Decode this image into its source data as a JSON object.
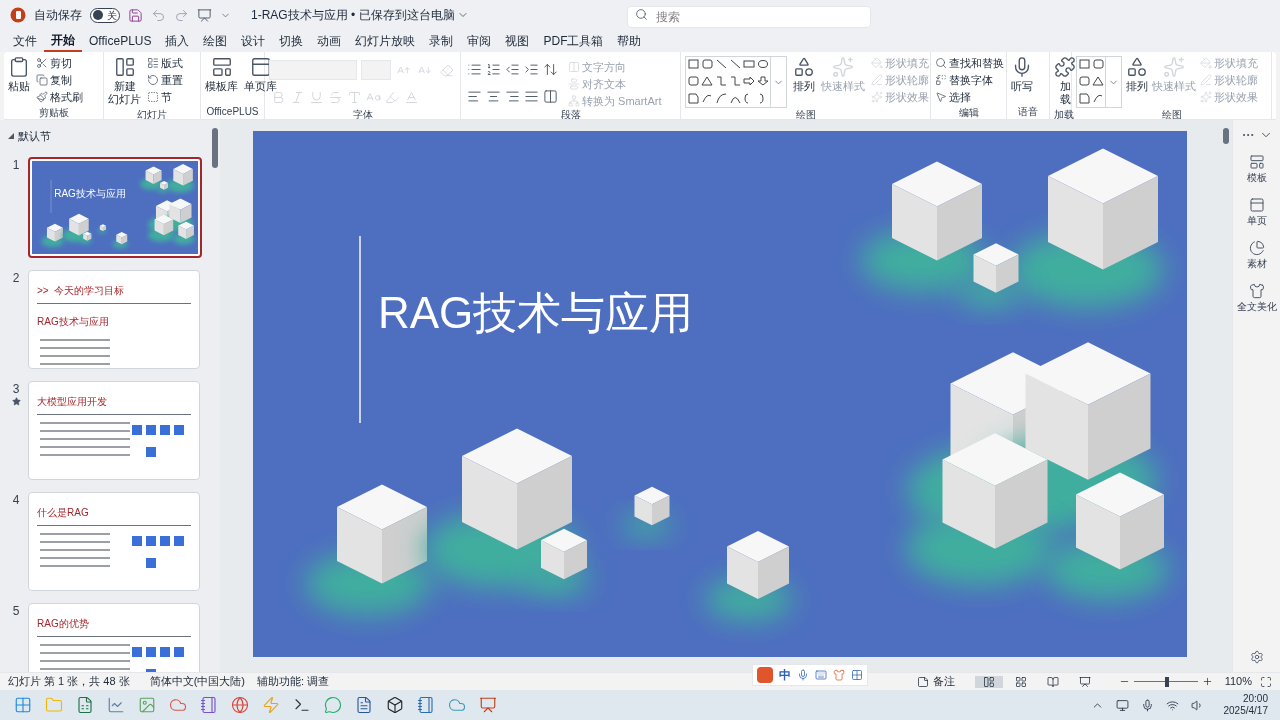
{
  "title_bar": {
    "autosave_label": "自动保存",
    "autosave": {
      "label": "关",
      "on": false
    },
    "document_title": "1-RAG技术与应用 • 已保存到这台电脑",
    "search": {
      "placeholder": "搜索"
    }
  },
  "menu_tabs": [
    {
      "label": "文件",
      "selected": false
    },
    {
      "label": "开始",
      "selected": true
    },
    {
      "label": "OfficePLUS",
      "selected": false
    },
    {
      "label": "插入",
      "selected": false
    },
    {
      "label": "绘图",
      "selected": false
    },
    {
      "label": "设计",
      "selected": false
    },
    {
      "label": "切换",
      "selected": false
    },
    {
      "label": "动画",
      "selected": false
    },
    {
      "label": "幻灯片放映",
      "selected": false
    },
    {
      "label": "录制",
      "selected": false
    },
    {
      "label": "审阅",
      "selected": false
    },
    {
      "label": "视图",
      "selected": false
    },
    {
      "label": "PDF工具箱",
      "selected": false
    },
    {
      "label": "帮助",
      "selected": false
    }
  ],
  "ribbon": [
    {
      "kind": "buttons",
      "label": "剪贴板",
      "items": [
        {
          "kind": "large",
          "lines": [
            "粘贴"
          ],
          "disabled": false
        },
        {
          "kind": "small",
          "label": "剪切",
          "disabled": false
        },
        {
          "kind": "small",
          "label": "复制",
          "disabled": false
        },
        {
          "kind": "small",
          "label": "格式刷",
          "disabled": false
        }
      ]
    },
    {
      "kind": "buttons",
      "label": "幻灯片",
      "items": [
        {
          "kind": "large",
          "lines": [
            "新建",
            "幻灯片"
          ],
          "disabled": false
        },
        {
          "kind": "small",
          "label": "版式",
          "disabled": false
        },
        {
          "kind": "small",
          "label": "重置",
          "disabled": false
        },
        {
          "kind": "small",
          "label": "节",
          "disabled": false
        }
      ]
    },
    {
      "kind": "buttons",
      "label": "OfficePLUS",
      "items": [
        {
          "kind": "large",
          "lines": [
            "模板库"
          ],
          "disabled": false
        },
        {
          "kind": "large",
          "lines": [
            "单页库"
          ],
          "disabled": false
        }
      ]
    },
    {
      "kind": "font",
      "label": "字体"
    },
    {
      "kind": "paragraph",
      "label": "段落",
      "items": [
        {
          "kind": "small",
          "label": "文字方向",
          "disabled": true
        },
        {
          "kind": "small",
          "label": "对齐文本",
          "disabled": true
        },
        {
          "kind": "small",
          "label": "转换为 SmartArt",
          "disabled": true
        }
      ]
    },
    {
      "kind": "drawing",
      "label": "绘图",
      "items": [
        {
          "kind": "large",
          "lines": [
            "排列"
          ],
          "disabled": false
        },
        {
          "kind": "large",
          "lines": [
            "快速样式"
          ],
          "disabled": true
        },
        {
          "kind": "small",
          "label": "形状填充",
          "disabled": true
        },
        {
          "kind": "small",
          "label": "形状轮廓",
          "disabled": true
        },
        {
          "kind": "small",
          "label": "形状效果",
          "disabled": true
        }
      ]
    },
    {
      "kind": "buttons",
      "label": "编辑",
      "items": [
        {
          "kind": "small",
          "label": "查找和替换",
          "disabled": false
        },
        {
          "kind": "small",
          "label": "替换字体",
          "disabled": false
        },
        {
          "kind": "small",
          "label": "选择",
          "disabled": false
        }
      ]
    },
    {
      "kind": "buttons",
      "label": "语音",
      "items": [
        {
          "kind": "large",
          "lines": [
            "听写"
          ],
          "disabled": false
        }
      ]
    },
    {
      "kind": "buttons",
      "label": "加载",
      "items": [
        {
          "kind": "large",
          "lines": [
            "加",
            "载"
          ],
          "disabled": false
        }
      ]
    },
    {
      "kind": "drawing",
      "label": "绘图",
      "items": [
        {
          "kind": "large",
          "lines": [
            "排列"
          ],
          "disabled": false
        },
        {
          "kind": "large",
          "lines": [
            "快速样式"
          ],
          "disabled": true
        },
        {
          "kind": "small",
          "label": "形状填充",
          "disabled": true
        },
        {
          "kind": "small",
          "label": "形状轮廓",
          "disabled": true
        },
        {
          "kind": "small",
          "label": "形状效果",
          "disabled": true
        }
      ]
    }
  ],
  "slides_panel": {
    "section": "默认节",
    "slides": [
      {
        "number": "1",
        "kind": "cover",
        "selected": true,
        "animated": false,
        "title": "RAG技术与应用"
      },
      {
        "number": "2",
        "kind": "content",
        "selected": false,
        "animated": false,
        "title": ">>  今天的学习目标",
        "subtitle": "RAG技术与应用"
      },
      {
        "number": "3",
        "kind": "content",
        "selected": false,
        "animated": true,
        "title": "大模型应用开发"
      },
      {
        "number": "4",
        "kind": "content",
        "selected": false,
        "animated": false,
        "title": "什么是RAG"
      },
      {
        "number": "5",
        "kind": "content",
        "selected": false,
        "animated": false,
        "title": "RAG的优势"
      }
    ]
  },
  "slide": {
    "title": "RAG技术与应用"
  },
  "side_pane": {
    "items": [
      {
        "label": "模板"
      },
      {
        "label": "单页"
      },
      {
        "label": "素材"
      },
      {
        "label": "全文美化"
      }
    ]
  },
  "status_bar": {
    "slide_info": "幻灯片 第 1 张，共 48 张",
    "language": "简体中文(中国大陆)",
    "accessibility": "辅助功能: 调查",
    "notes": "备注",
    "views": [
      {
        "kind": "normal",
        "selected": true
      },
      {
        "kind": "sorter",
        "selected": false
      },
      {
        "kind": "reading",
        "selected": false
      },
      {
        "kind": "slideshow",
        "selected": false
      }
    ],
    "zoom": {
      "level": 0.52,
      "reading": "110%"
    }
  },
  "ime_toolbar": {
    "mode": "中"
  },
  "taskbar": {
    "time": "20:00",
    "date": "2025/4/17"
  }
}
